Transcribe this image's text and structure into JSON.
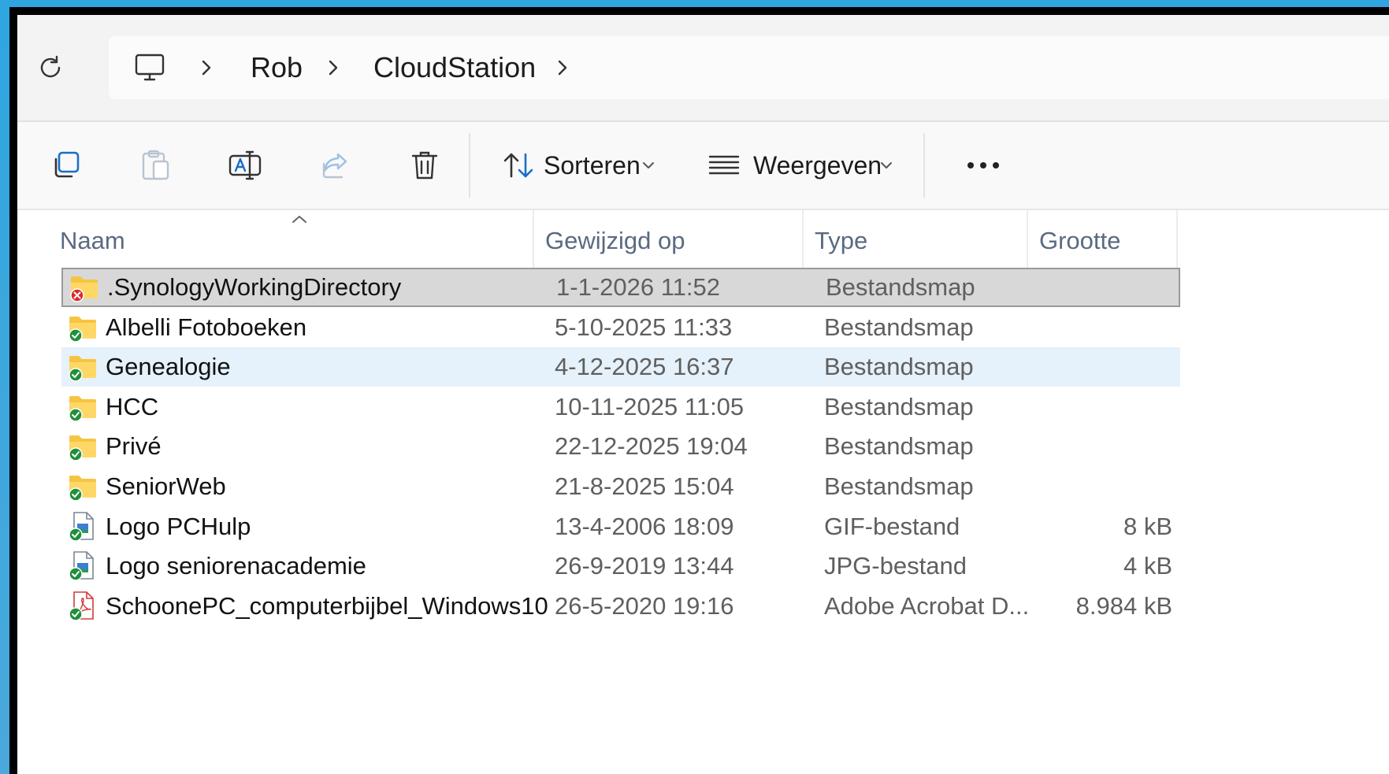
{
  "breadcrumb": {
    "root_icon": "computer-icon",
    "items": [
      "Rob",
      "CloudStation"
    ]
  },
  "toolbar": {
    "sort_label": "Sorteren",
    "view_label": "Weergeven",
    "icons": [
      "copy-icon",
      "paste-icon",
      "rename-icon",
      "share-icon",
      "delete-icon",
      "sort-icon",
      "view-icon",
      "more-icon"
    ]
  },
  "columns": {
    "name": "Naam",
    "modified": "Gewijzigd op",
    "type": "Type",
    "size": "Grootte"
  },
  "files": [
    {
      "name": ".SynologyWorkingDirectory",
      "modified": "1-1-2026 11:52",
      "type": "Bestandsmap",
      "size": "",
      "kind": "folder",
      "sync": "error",
      "state": "selected"
    },
    {
      "name": "Albelli Fotoboeken",
      "modified": "5-10-2025 11:33",
      "type": "Bestandsmap",
      "size": "",
      "kind": "folder",
      "sync": "ok",
      "state": ""
    },
    {
      "name": "Genealogie",
      "modified": "4-12-2025 16:37",
      "type": "Bestandsmap",
      "size": "",
      "kind": "folder",
      "sync": "ok",
      "state": "hover"
    },
    {
      "name": "HCC",
      "modified": "10-11-2025 11:05",
      "type": "Bestandsmap",
      "size": "",
      "kind": "folder",
      "sync": "ok",
      "state": ""
    },
    {
      "name": "Privé",
      "modified": "22-12-2025 19:04",
      "type": "Bestandsmap",
      "size": "",
      "kind": "folder",
      "sync": "ok",
      "state": ""
    },
    {
      "name": "SeniorWeb",
      "modified": "21-8-2025 15:04",
      "type": "Bestandsmap",
      "size": "",
      "kind": "folder",
      "sync": "ok",
      "state": ""
    },
    {
      "name": "Logo PCHulp",
      "modified": "13-4-2006 18:09",
      "type": "GIF-bestand",
      "size": "8 kB",
      "kind": "image",
      "sync": "ok",
      "state": ""
    },
    {
      "name": "Logo seniorenacademie",
      "modified": "26-9-2019 13:44",
      "type": "JPG-bestand",
      "size": "4 kB",
      "kind": "image",
      "sync": "ok",
      "state": ""
    },
    {
      "name": "SchoonePC_computerbijbel_Windows10",
      "modified": "26-5-2020 19:16",
      "type": "Adobe Acrobat D...",
      "size": "8.984 kB",
      "kind": "pdf",
      "sync": "ok",
      "state": ""
    }
  ],
  "colors": {
    "folder": "#f5c542",
    "sync_ok": "#1f8f3a",
    "sync_error": "#d92b2b",
    "selected_bg": "#d8d8d8",
    "hover_bg": "#e5f1fb"
  }
}
